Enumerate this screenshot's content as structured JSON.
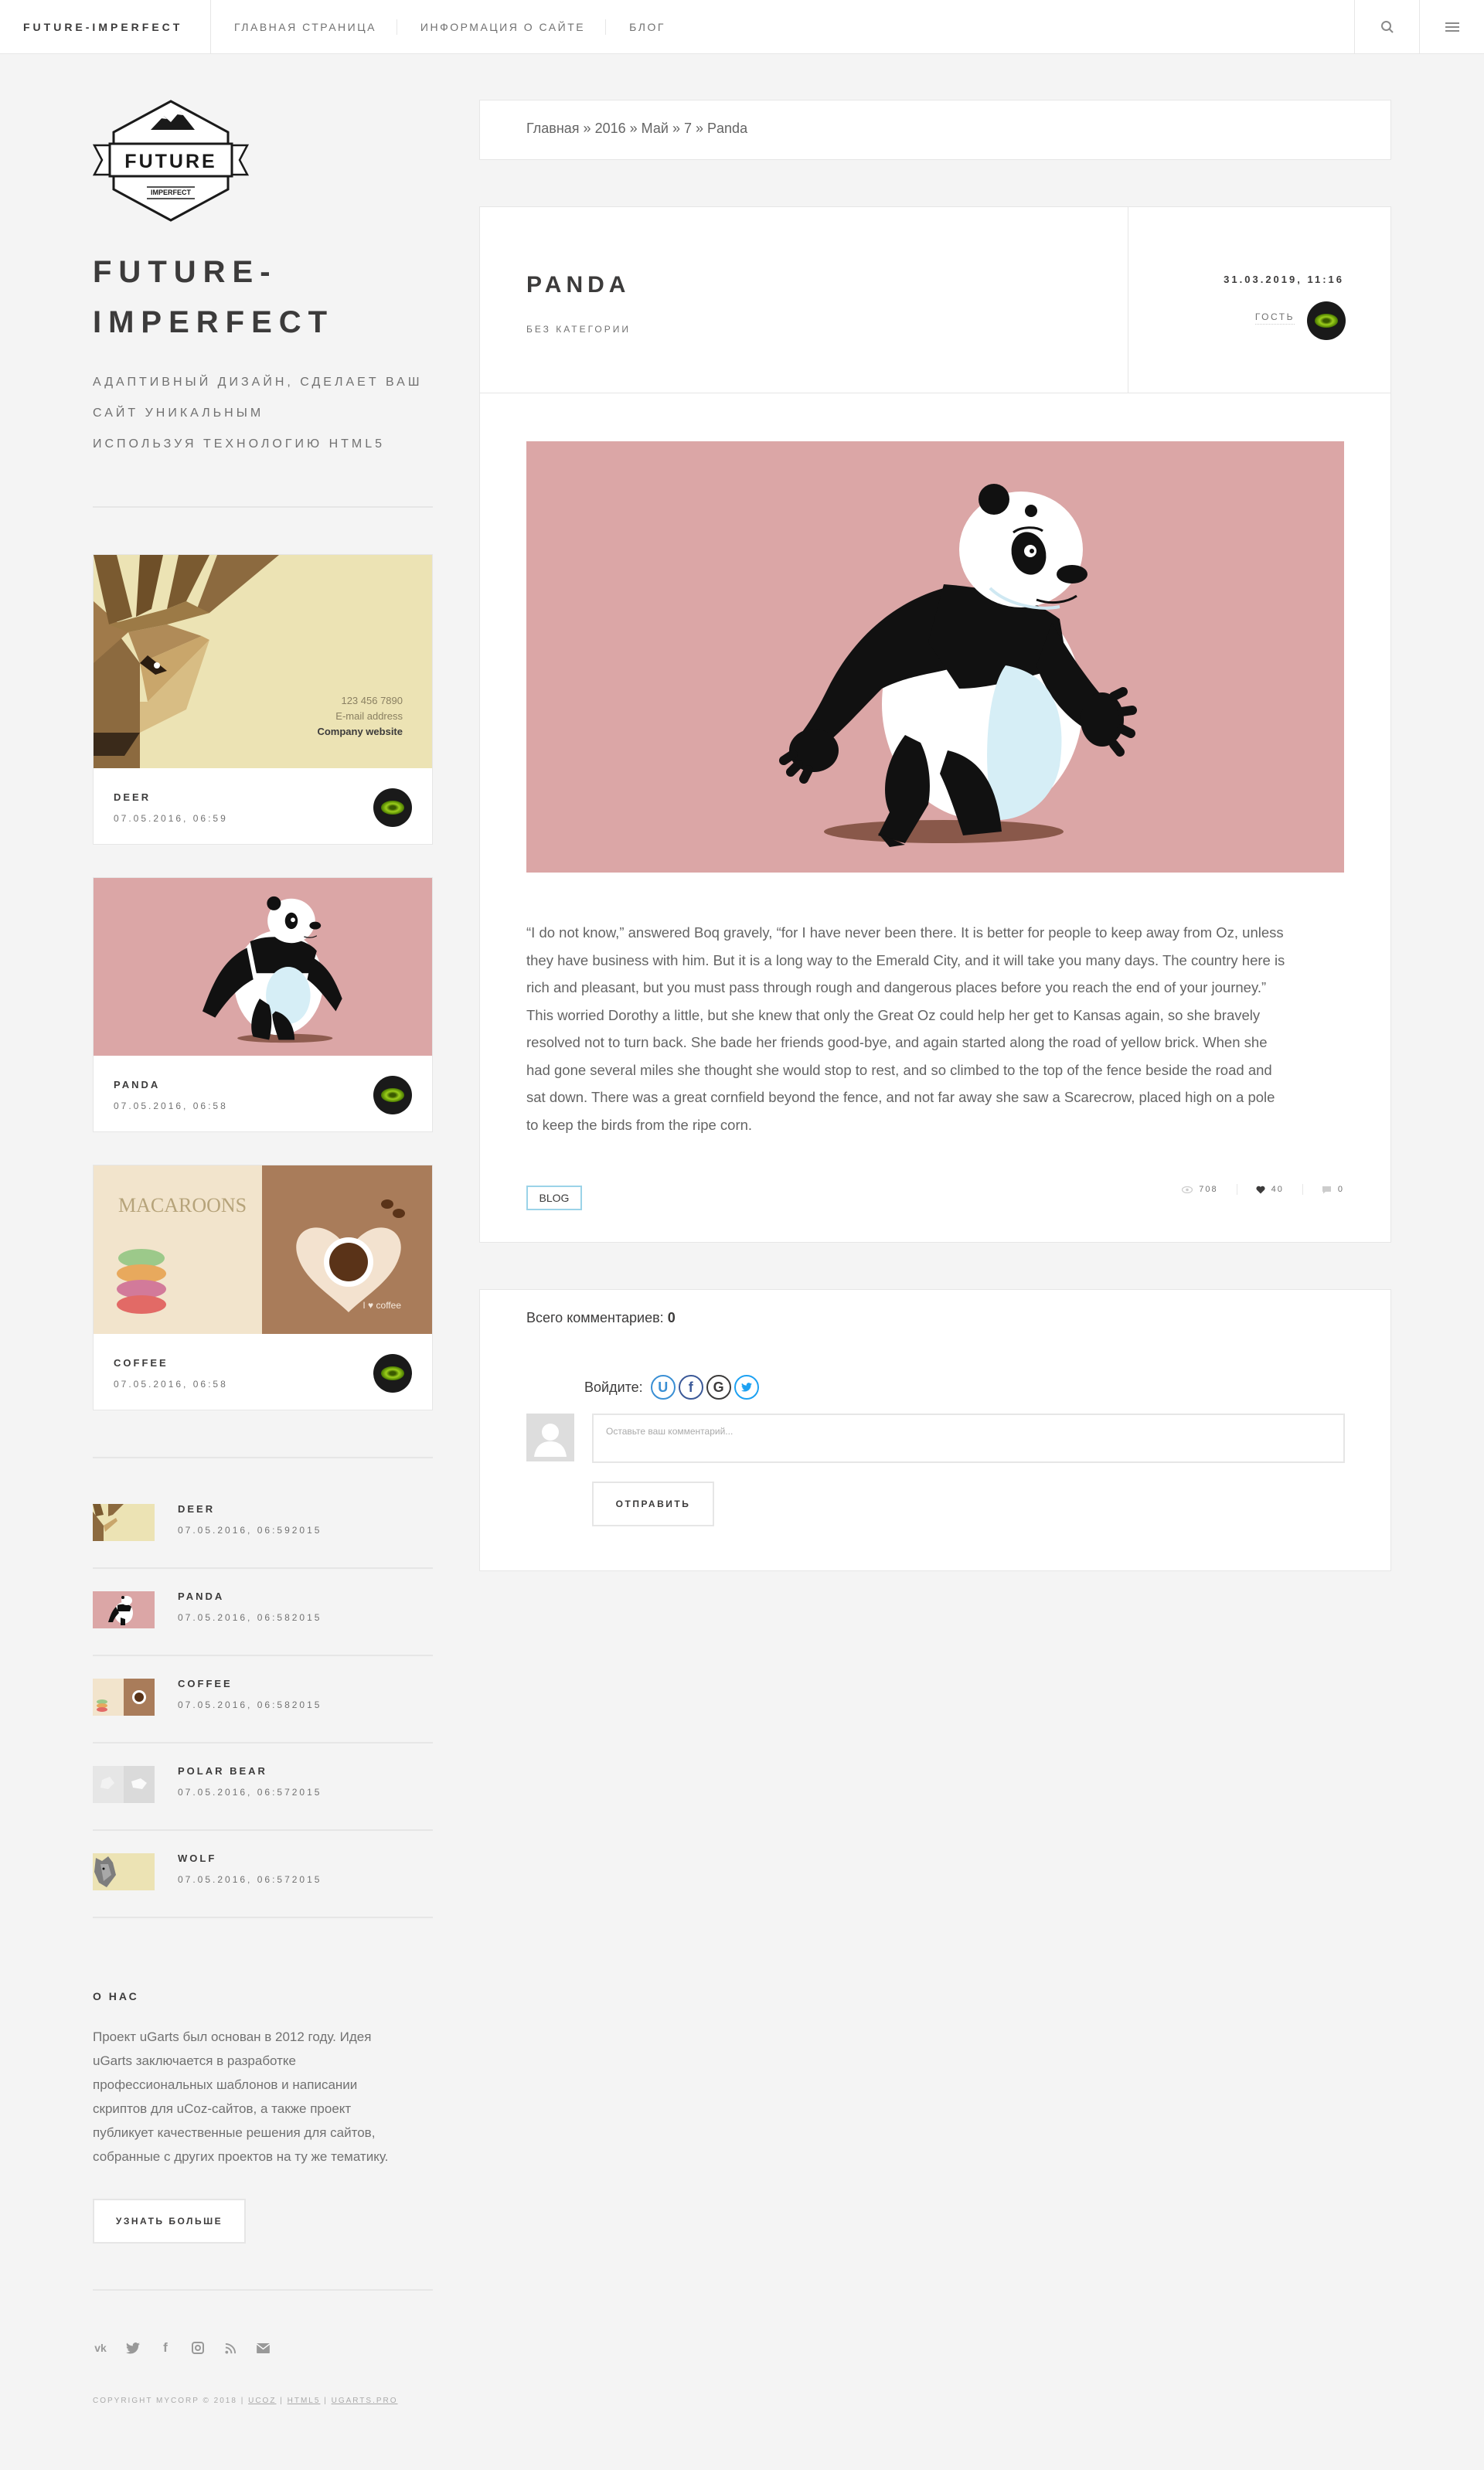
{
  "header": {
    "brand": "FUTURE-IMPERFECT",
    "nav": [
      "ГЛАВНАЯ СТРАНИЦА",
      "ИНФОРМАЦИЯ О САЙТЕ",
      "БЛОГ"
    ],
    "icons": [
      "search-icon",
      "menu-icon"
    ]
  },
  "sidebar": {
    "logo": {
      "word": "FUTURE",
      "sub": "IMPERFECT"
    },
    "title_line1": "FUTURE-",
    "title_line2": "IMPERFECT",
    "tagline": [
      "АДАПТИВНЫЙ ДИЗАЙН, СДЕЛАЕТ ВАШ",
      "САЙТ УНИКАЛЬНЫМ",
      "ИСПОЛЬЗУЯ ТЕХНОЛОГИЮ HTML5"
    ],
    "cards": [
      {
        "title": "DEER",
        "date": "07.05.2016, 06:59",
        "image_text": [
          "123 456 7890",
          "E-mail address",
          "Company website"
        ]
      },
      {
        "title": "PANDA",
        "date": "07.05.2016, 06:58"
      },
      {
        "title": "COFFEE",
        "date": "07.05.2016, 06:58",
        "image_text": [
          "MACAROONS",
          "I ♥ coffee"
        ]
      }
    ],
    "mini_posts": [
      {
        "title": "DEER",
        "date": "07.05.2016, 06:592015"
      },
      {
        "title": "PANDA",
        "date": "07.05.2016, 06:582015"
      },
      {
        "title": "COFFEE",
        "date": "07.05.2016, 06:582015"
      },
      {
        "title": "POLAR BEAR",
        "date": "07.05.2016, 06:572015"
      },
      {
        "title": "WOLF",
        "date": "07.05.2016, 06:572015"
      }
    ],
    "about": {
      "heading": "О НАС",
      "lines": [
        "Проект uGarts был основан в 2012 году. Идея",
        "uGarts заключается в разработке",
        "профессиональных шаблонов и написании",
        "скриптов для uCoz-сайтов, а также проект",
        "публикует качественные решения для сайтов,",
        "собранные с других проектов на ту же тематику."
      ],
      "button": "УЗНАТЬ БОЛЬШЕ"
    },
    "social_icons": [
      "vk-icon",
      "twitter-icon",
      "facebook-icon",
      "instagram-icon",
      "rss-icon",
      "mail-icon"
    ],
    "copyright": {
      "prefix": "COPYRIGHT MYCORP © 2018",
      "links": [
        "UCOZ",
        "HTML5",
        "UGARTS.PRO"
      ],
      "separator": "|"
    }
  },
  "main": {
    "breadcrumb": [
      "Главная",
      "2016",
      "Май",
      "7",
      "Panda"
    ],
    "breadcrumb_separator": "»",
    "post": {
      "title": "PANDA",
      "category": "БЕЗ КАТЕГОРИИ",
      "datetime": "31.03.2019, 11:16",
      "author": "ГОСТЬ",
      "text_lines": [
        "“I do not know,” answered Boq gravely, “for I have never been there. It is better for people to keep away from Oz, unless",
        "they have business with him. But it is a long way to the Emerald City, and it will take you many days. The country here is",
        "rich and pleasant, but you must pass through rough and dangerous places before you reach the end of your journey.”",
        "This worried Dorothy a little, but she knew that only the Great Oz could help her get to Kansas again, so she bravely",
        "resolved not to turn back. She bade her friends good-bye, and again started along the road of yellow brick. When she",
        "had gone several miles she thought she would stop to rest, and so climbed to the top of the fence beside the road and",
        "sat down. There was a great cornfield beyond the fence, and not far away she saw a Scarecrow, placed high on a pole",
        "to keep the birds from the ripe corn."
      ],
      "tag": "BLOG",
      "views": "708",
      "likes": "40",
      "comments": "0"
    },
    "comments": {
      "total_label": "Всего комментариев:",
      "total": "0",
      "login_label": "Войдите:",
      "login_icons": [
        "ucoz-icon",
        "facebook-icon",
        "google-icon",
        "twitter-icon"
      ],
      "placeholder": "Оставьте ваш комментарий...",
      "submit": "ОТПРАВИТЬ"
    }
  },
  "colors": {
    "background": "#f4f4f4",
    "panda_bg": "#dba6a6",
    "deer_bg": "#ece3b4",
    "tag_border": "#9bd3e8",
    "text_dark": "#3c3b3b",
    "text_muted": "#717171"
  }
}
